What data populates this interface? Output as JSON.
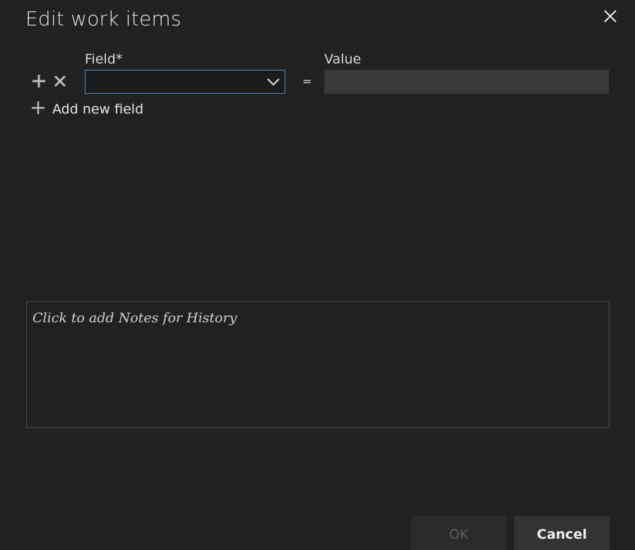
{
  "dialog": {
    "title": "Edit work items",
    "close_icon": "close-icon"
  },
  "field_row": {
    "field_label": "Field*",
    "value_label": "Value",
    "field_selected": "",
    "equals": "=",
    "value_text": "",
    "add_icon": "plus-icon",
    "remove_icon": "x-icon",
    "dropdown_icon": "chevron-down-icon"
  },
  "add_new_field": {
    "label": "Add new field",
    "icon": "plus-icon"
  },
  "notes": {
    "placeholder": "Click to add Notes for History"
  },
  "buttons": {
    "ok": "OK",
    "cancel": "Cancel"
  },
  "colors": {
    "background": "#212121",
    "focus_border": "#4f8ac9",
    "value_box": "#3a3a3a"
  }
}
